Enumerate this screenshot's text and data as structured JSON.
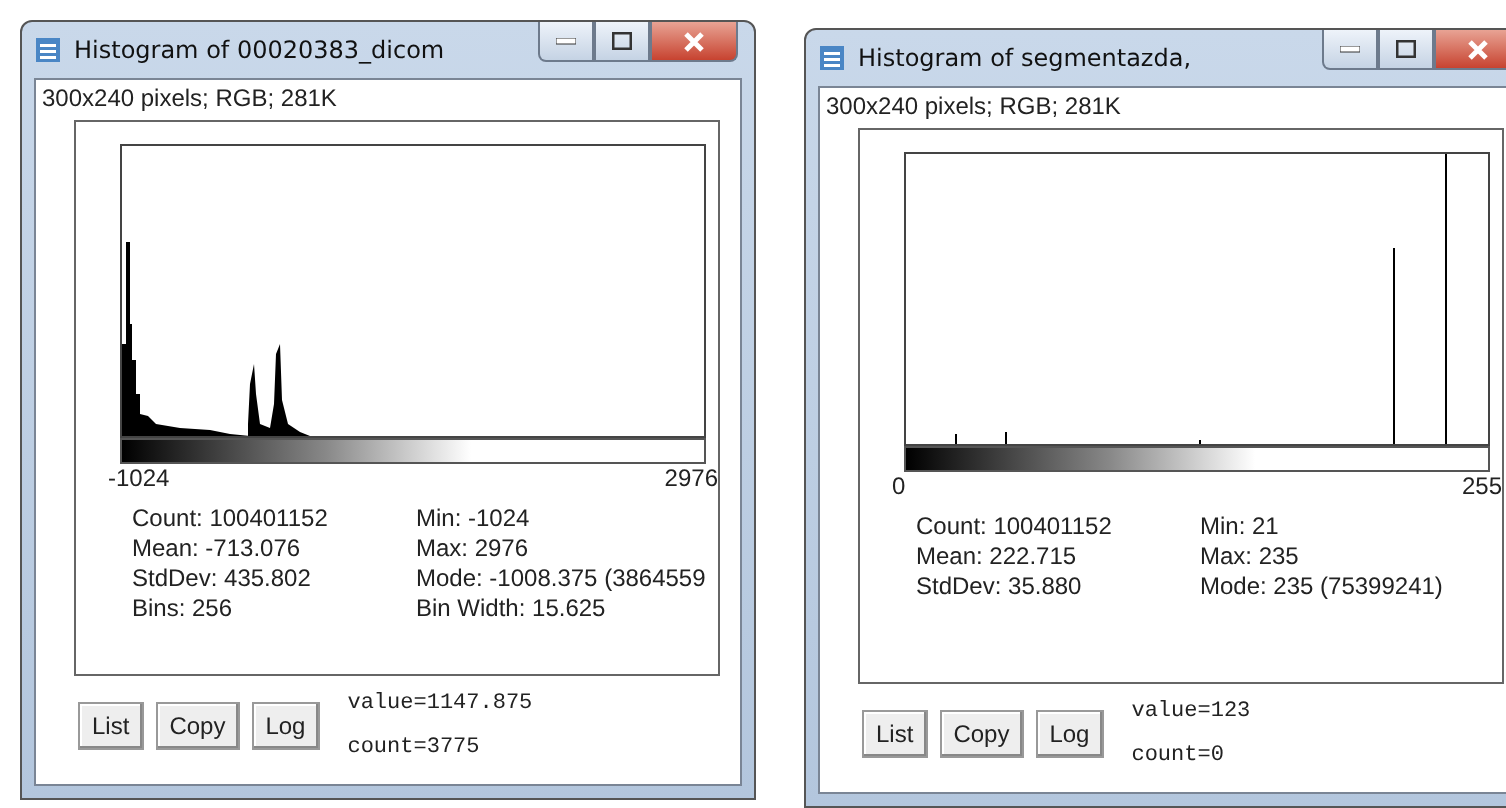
{
  "windows": [
    {
      "title": "Histogram of 00020383_dicom",
      "info": "300x240 pixels; RGB; 281K",
      "histogram": {
        "kind": "spread"
      },
      "axis_min": "-1024",
      "axis_max": "2976",
      "stats_left": [
        "Count: 100401152",
        "Mean: -713.076",
        "StdDev: 435.802",
        "Bins: 256"
      ],
      "stats_right": [
        "Min: -1024",
        "Max: 2976",
        "Mode: -1008.375 (3864559",
        "Bin Width: 15.625"
      ],
      "buttons": [
        "List",
        "Copy",
        "Log"
      ],
      "value": "value=1147.875",
      "count": "count=3775"
    },
    {
      "title": "Histogram of segmentazda,",
      "info": "300x240 pixels; RGB; 281K",
      "histogram": {
        "kind": "spikes"
      },
      "axis_min": "0",
      "axis_max": "255",
      "stats_left": [
        "Count: 100401152",
        "Mean: 222.715",
        "StdDev: 35.880"
      ],
      "stats_right": [
        "Min: 21",
        "Max: 235",
        "Mode: 235 (75399241)"
      ],
      "buttons": [
        "List",
        "Copy",
        "Log"
      ],
      "value": "value=123",
      "count": "count=0"
    }
  ]
}
